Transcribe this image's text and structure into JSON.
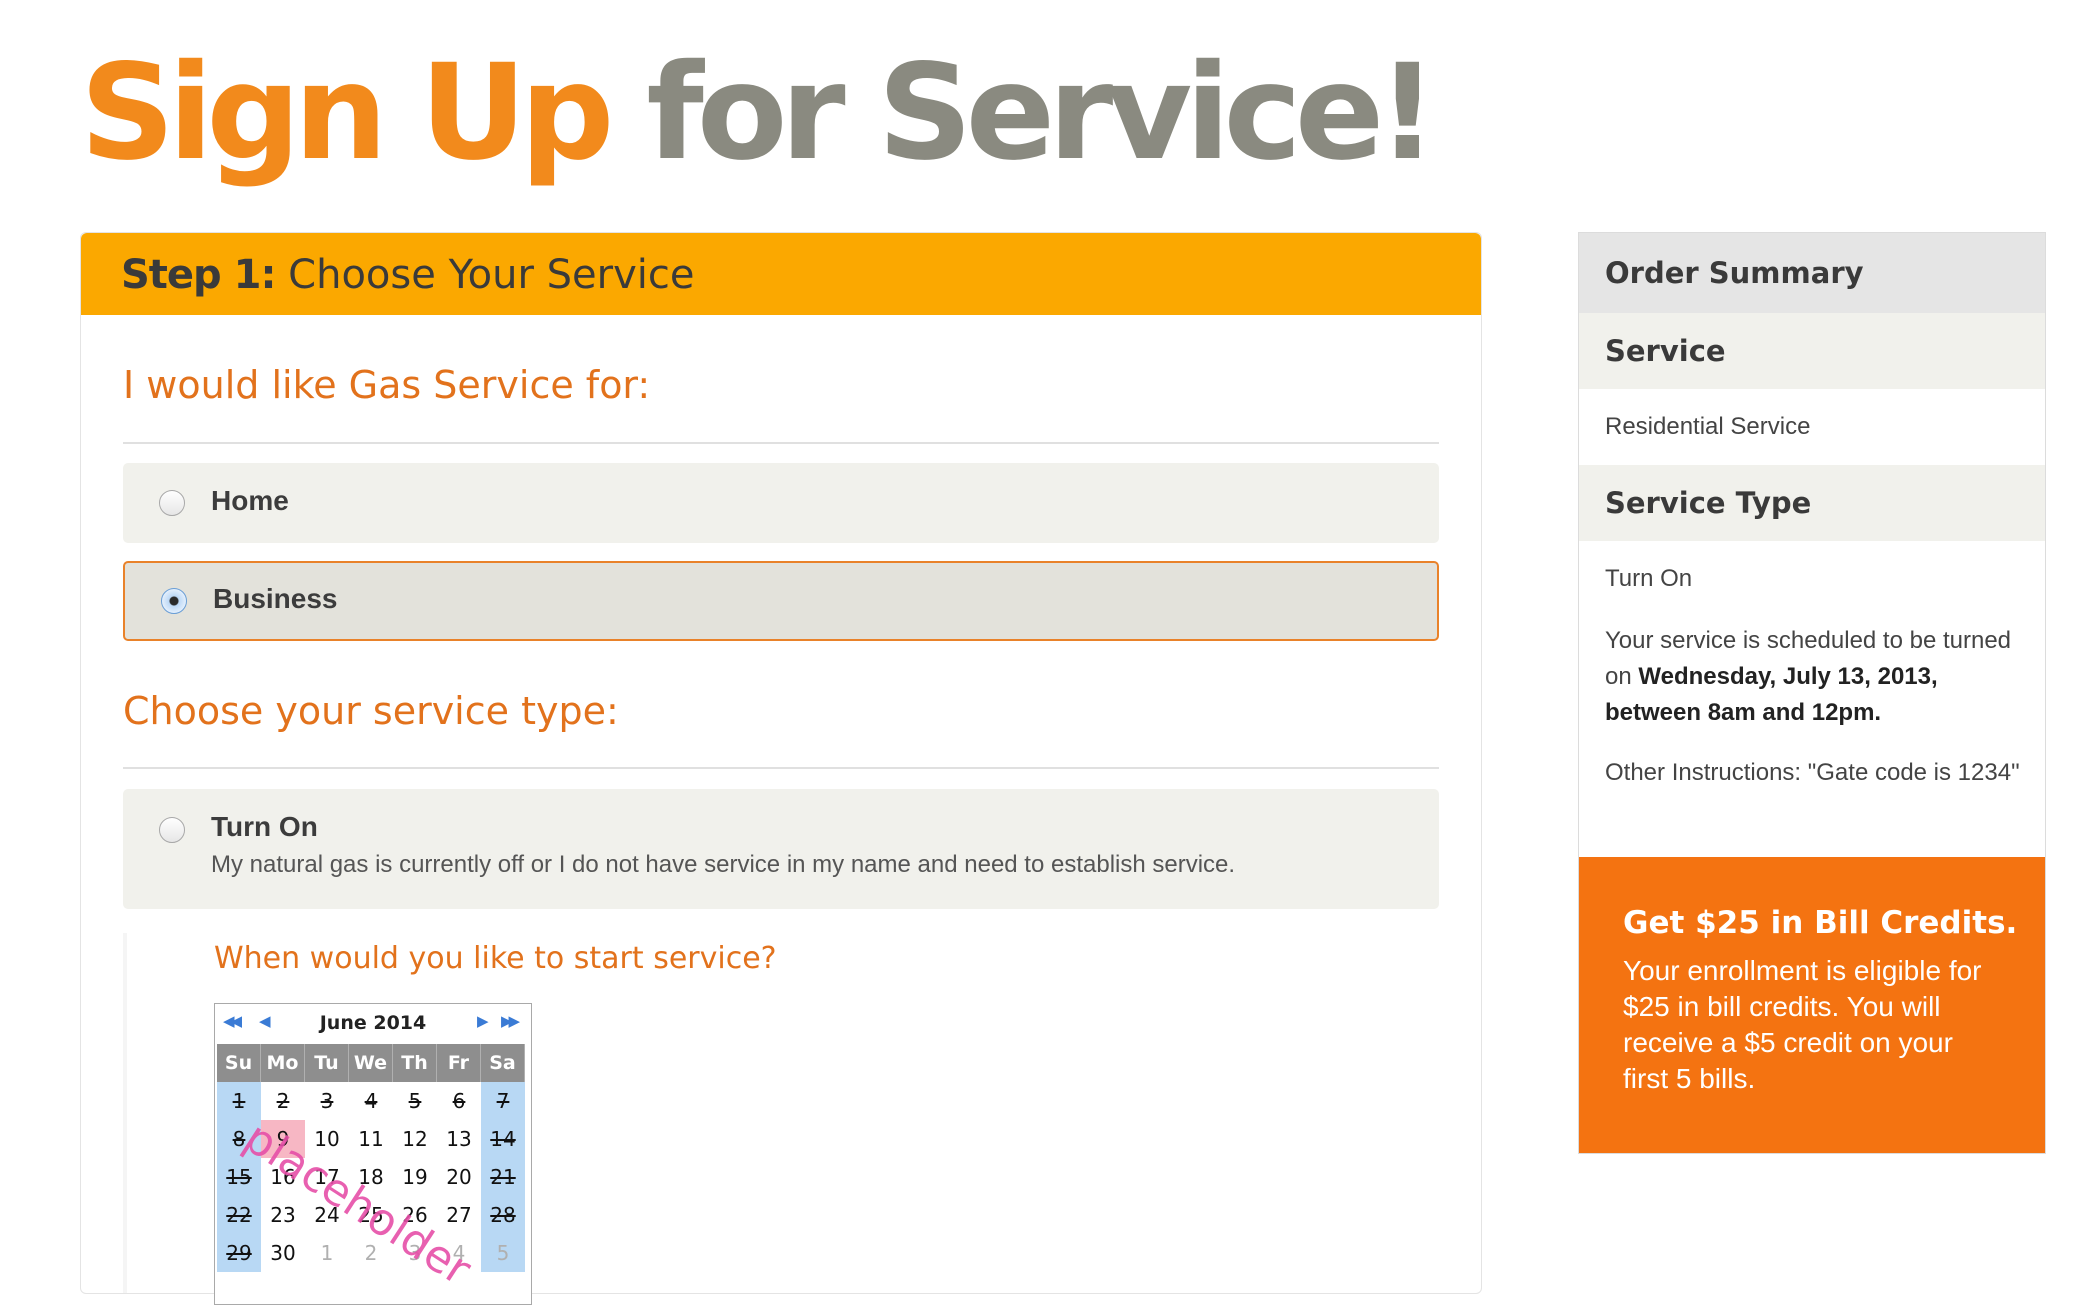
{
  "page": {
    "title_part1": "Sign Up",
    "title_part2": "for Service!"
  },
  "step": {
    "number_label": "Step 1:",
    "title": "Choose Your Service"
  },
  "service_for": {
    "heading": "I would like Gas Service for:",
    "options": [
      {
        "label": "Home",
        "selected": false
      },
      {
        "label": "Business",
        "selected": true
      }
    ]
  },
  "service_type": {
    "heading": "Choose your service type:",
    "options": [
      {
        "label": "Turn On",
        "description": "My natural gas is currently off or I do not have service in my name and need to establish service.",
        "selected": false
      }
    ]
  },
  "start_service": {
    "question": "When would you like to start service?",
    "calendar": {
      "month_label": "June 2014",
      "nav_prev_year": "◀◀",
      "nav_prev_month": "◀",
      "nav_next_month": "▶",
      "nav_next_year": "▶▶",
      "weekdays": [
        "Su",
        "Mo",
        "Tu",
        "We",
        "Th",
        "Fr",
        "Sa"
      ],
      "weeks": [
        [
          "1",
          "2",
          "3",
          "4",
          "5",
          "6",
          "7"
        ],
        [
          "8",
          "9",
          "10",
          "11",
          "12",
          "13",
          "14"
        ],
        [
          "15",
          "16",
          "17",
          "18",
          "19",
          "20",
          "21"
        ],
        [
          "22",
          "23",
          "24",
          "25",
          "26",
          "27",
          "28"
        ],
        [
          "29",
          "30",
          "1",
          "2",
          "3",
          "4",
          "5"
        ]
      ],
      "watermark": "placeholder"
    }
  },
  "order_summary": {
    "title": "Order Summary",
    "service_heading": "Service",
    "service_value": "Residential Service",
    "service_type_heading": "Service Type",
    "service_type_value": "Turn On",
    "schedule_prefix": "Your service is scheduled to be turned on ",
    "schedule_bold": "Wednesday, July 13, 2013, between 8am and 12pm.",
    "instructions": "Other Instructions: \"Gate code is 1234\""
  },
  "promo": {
    "title": "Get $25 in Bill Credits.",
    "body": "Your enrollment is eligible for $25 in bill credits. You will receive a $5 credit on your first 5 bills.",
    "background_color": "#f47311"
  },
  "colors": {
    "accent_orange": "#e2721c",
    "header_yellow": "#fba800",
    "title_gray": "#8a8a80"
  }
}
